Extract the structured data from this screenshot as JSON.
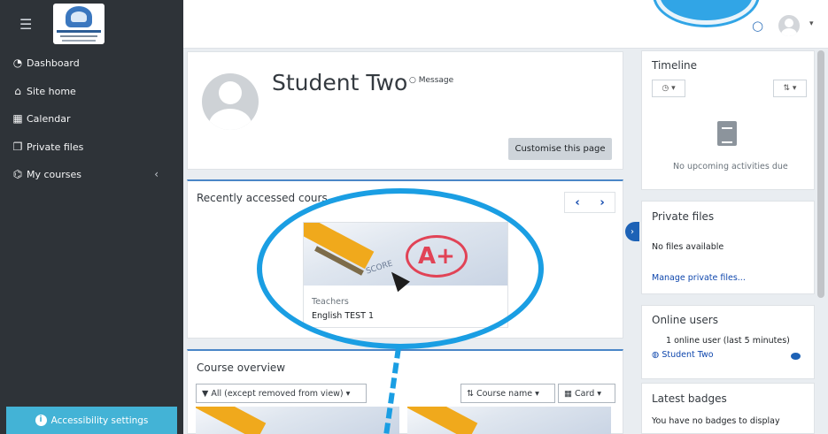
{
  "sidebar": {
    "items": [
      {
        "label": "Dashboard",
        "icon": "dashboard-icon"
      },
      {
        "label": "Site home",
        "icon": "home-icon"
      },
      {
        "label": "Calendar",
        "icon": "calendar-icon"
      },
      {
        "label": "Private files",
        "icon": "files-icon"
      },
      {
        "label": "My courses",
        "icon": "graduation-cap-icon"
      }
    ],
    "accessibility": "Accessibility settings"
  },
  "profile": {
    "name": "Student Two",
    "message_label": "Message",
    "customise_label": "Customise this page"
  },
  "recent": {
    "title": "Recently accessed cours",
    "course_category": "Teachers",
    "course_name": "English TEST 1",
    "grade": "A+",
    "score_label": "SCORE"
  },
  "overview": {
    "title": "Course overview",
    "filter_label": "All (except removed from view)",
    "sort_label": "Course name",
    "view_label": "Card"
  },
  "timeline": {
    "title": "Timeline",
    "empty": "No upcoming activities due"
  },
  "private_files": {
    "title": "Private files",
    "empty": "No files available",
    "manage_link": "Manage private files..."
  },
  "online_users": {
    "title": "Online users",
    "summary": "1 online user (last 5 minutes)",
    "user": "Student Two"
  },
  "badges": {
    "title": "Latest badges",
    "empty": "You have no badges to display"
  },
  "colors": {
    "sidebar": "#2e3338",
    "accent": "#1a9ee3",
    "link": "#0f47ad",
    "accessibility_button": "#43b3d6"
  }
}
